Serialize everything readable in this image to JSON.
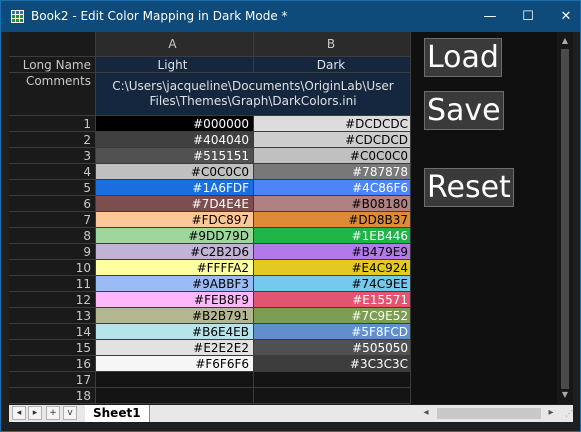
{
  "window": {
    "title": "Book2 - Edit Color Mapping in Dark Mode *",
    "minimize_glyph": "—",
    "maximize_glyph": "☐",
    "close_glyph": "✕"
  },
  "grid": {
    "columns": [
      "A",
      "B"
    ],
    "long_name_label": "Long Name",
    "long_names": [
      "Light",
      "Dark"
    ],
    "comments_label": "Comments",
    "comment": "C:\\Users\\jacqueline\\Documents\\OriginLab\\User Files\\Themes\\Graph\\DarkColors.ini",
    "rows": [
      {
        "n": "1",
        "light": "#000000",
        "dark": "#DCDCDC"
      },
      {
        "n": "2",
        "light": "#404040",
        "dark": "#CDCDCD"
      },
      {
        "n": "3",
        "light": "#515151",
        "dark": "#C0C0C0"
      },
      {
        "n": "4",
        "light": "#C0C0C0",
        "dark": "#787878"
      },
      {
        "n": "5",
        "light": "#1A6FDF",
        "dark": "#4C86F6"
      },
      {
        "n": "6",
        "light": "#7D4E4E",
        "dark": "#B08180"
      },
      {
        "n": "7",
        "light": "#FDC897",
        "dark": "#DD8B37"
      },
      {
        "n": "8",
        "light": "#9DD79D",
        "dark": "#1EB446"
      },
      {
        "n": "9",
        "light": "#C2B2D6",
        "dark": "#B479E9"
      },
      {
        "n": "10",
        "light": "#FFFFA2",
        "dark": "#E4C924"
      },
      {
        "n": "11",
        "light": "#9ABBF3",
        "dark": "#74C9EE"
      },
      {
        "n": "12",
        "light": "#FEB8F9",
        "dark": "#E15571"
      },
      {
        "n": "13",
        "light": "#B2B791",
        "dark": "#7C9E52"
      },
      {
        "n": "14",
        "light": "#B6E4EB",
        "dark": "#5F8FCD"
      },
      {
        "n": "15",
        "light": "#E2E2E2",
        "dark": "#505050"
      },
      {
        "n": "16",
        "light": "#F6F6F6",
        "dark": "#3C3C3C"
      },
      {
        "n": "17",
        "light": "",
        "dark": ""
      },
      {
        "n": "18",
        "light": "",
        "dark": ""
      }
    ]
  },
  "buttons": {
    "load": "Load",
    "save": "Save",
    "reset": "Reset"
  },
  "bottom": {
    "first_glyph": "◂",
    "prev_glyph": "▸",
    "add_glyph": "+",
    "menu_glyph": "v",
    "sheet_tab": "Sheet1",
    "scroll_left_glyph": "◂",
    "scroll_right_glyph": "▸"
  },
  "vscroll": {
    "up_glyph": "▲",
    "down_glyph": "▼"
  }
}
